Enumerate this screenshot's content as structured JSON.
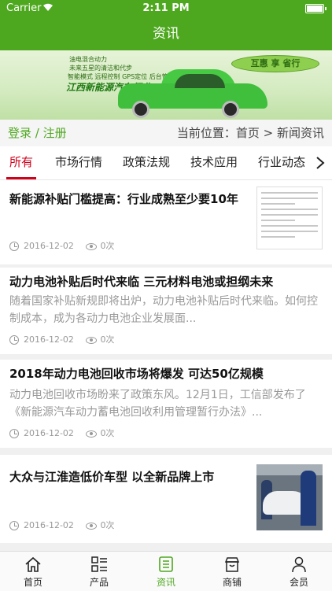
{
  "status_bar": {
    "carrier": "Carrier",
    "time": "2:11 PM"
  },
  "nav": {
    "title": "资讯"
  },
  "banner": {
    "lines": [
      "油电混合动力",
      "未来五星的清洁和代步",
      "智能模式   远程控制   GPS定位   后台管理"
    ],
    "brand": "江西新能源汽车行业",
    "leaf_text": "互惠 享 省行"
  },
  "location_bar": {
    "login": "登录 / 注册",
    "location": "当前位置：首页 > 新闻资讯"
  },
  "tabs": [
    "所有",
    "市场行情",
    "政策法规",
    "技术应用",
    "行业动态"
  ],
  "articles": [
    {
      "title": "新能源补贴门槛提高：行业成熟至少要10年",
      "summary": "",
      "date": "2016-12-02",
      "views": "0次"
    },
    {
      "title": "动力电池补贴后时代来临 三元材料电池或担纲未来",
      "summary": "随着国家补贴新规即将出炉，动力电池补贴后时代来临。如何控制成本，成为各动力电池企业发展面...",
      "date": "2016-12-02",
      "views": "0次"
    },
    {
      "title": "2018年动力电池回收市场将爆发 可达50亿规模",
      "summary": "动力电池回收市场盼来了政策东风。12月1日，工信部发布了《新能源汽车动力蓄电池回收利用管理暂行办法》...",
      "date": "2016-12-02",
      "views": "0次"
    },
    {
      "title": "大众与江淮造低价车型 以全新品牌上市",
      "summary": "",
      "date": "2016-12-02",
      "views": "0次"
    }
  ],
  "tab_bar": [
    {
      "label": "首页",
      "icon": "home-icon"
    },
    {
      "label": "产品",
      "icon": "grid-list-icon"
    },
    {
      "label": "资讯",
      "icon": "news-icon",
      "active": true
    },
    {
      "label": "商铺",
      "icon": "shop-icon"
    },
    {
      "label": "会员",
      "icon": "user-icon"
    }
  ],
  "colors": {
    "brand_green": "#4ea81f",
    "active_tab_red": "#d0021b"
  }
}
